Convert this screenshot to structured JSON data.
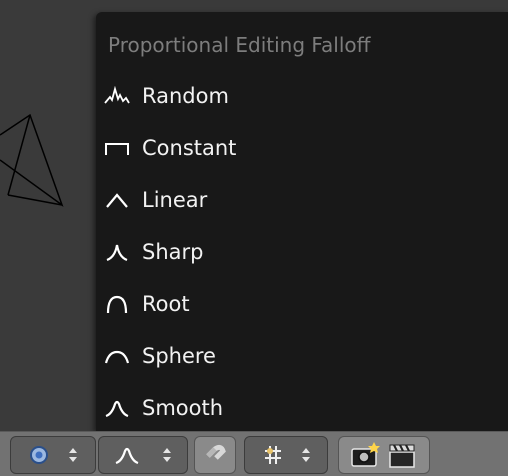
{
  "menu": {
    "title": "Proportional Editing Falloff",
    "items": [
      {
        "label": "Random",
        "icon": "random-falloff-icon"
      },
      {
        "label": "Constant",
        "icon": "constant-falloff-icon"
      },
      {
        "label": "Linear",
        "icon": "linear-falloff-icon"
      },
      {
        "label": "Sharp",
        "icon": "sharp-falloff-icon"
      },
      {
        "label": "Root",
        "icon": "root-falloff-icon"
      },
      {
        "label": "Sphere",
        "icon": "sphere-falloff-icon"
      },
      {
        "label": "Smooth",
        "icon": "smooth-falloff-icon"
      }
    ]
  },
  "header": {
    "pivot_icon": "pivot-point-icon",
    "falloff_icon": "smooth-falloff-icon",
    "snap_icon": "magnet-icon",
    "snap_element_icon": "snap-increment-icon",
    "render_icon": "camera-render-icon",
    "animation_icon": "clapperboard-icon"
  },
  "colors": {
    "menu_bg": "#181818",
    "viewport_bg": "#3a3a3a",
    "header_bg": "#727272",
    "title_text": "#7d7d7d",
    "item_text": "#f2f2f2"
  }
}
